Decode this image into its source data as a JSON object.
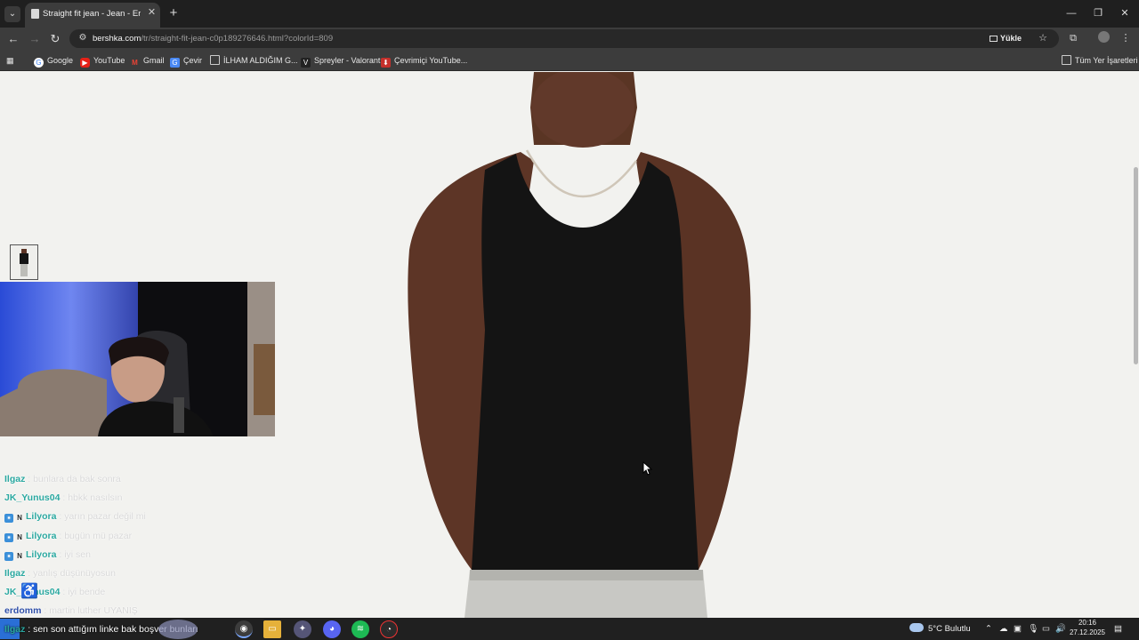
{
  "browser": {
    "tab_title": "Straight fit jean - Jean - Erkek |",
    "url_host": "bershka.com",
    "url_path": "/tr/straight-fit-jean-c0p189276646.html?colorId=809",
    "install_label": "Yükle",
    "bookmarks": [
      {
        "label": "Google",
        "icon": "google-icon"
      },
      {
        "label": "YouTube",
        "icon": "youtube-icon"
      },
      {
        "label": "Gmail",
        "icon": "gmail-icon"
      },
      {
        "label": "Çevir",
        "icon": "translate-icon"
      },
      {
        "label": "İLHAM ALDIĞIM G...",
        "icon": "folder-icon"
      },
      {
        "label": "Spreyler - Valorant",
        "icon": "valorant-icon"
      },
      {
        "label": "Çevrimiçi YouTube...",
        "icon": "bookmark-icon"
      }
    ],
    "all_bookmarks_label": "Tüm Yer İşaretleri"
  },
  "chat": [
    {
      "user": "Ilgaz",
      "message": " : bunlara da bak sonra",
      "badges": false
    },
    {
      "user": "JK_Yunus04",
      "message": " : hbkk nasılsın",
      "badges": false
    },
    {
      "user": "Lilyora",
      "message": " : yarın pazar değil mi",
      "badges": true
    },
    {
      "user": "Lilyora",
      "message": " : bugün mü pazar",
      "badges": true
    },
    {
      "user": "Lilyora",
      "message": " : iyi sen",
      "badges": true
    },
    {
      "user": "Ilgaz",
      "message": " : yanlış düşünüyosun",
      "badges": false
    },
    {
      "user": "JK_Yunus04",
      "message": " : iyi bende",
      "badges": false
    },
    {
      "user": "erdomm",
      "message": " : martin luther UYANIŞ",
      "badges": false
    },
    {
      "user": "Ilgaz",
      "message": " : sen son attığım linke bak boşver bunları",
      "badges": false
    }
  ],
  "taskbar": {
    "weather": "5°C  Bulutlu",
    "time": "20:16",
    "date": "27.12.2025"
  },
  "colors": {
    "page_bg": "#f2f2ef",
    "chrome_dark": "#1f1f1f",
    "toolbar": "#3c3c3c",
    "chat_user": "#2aa8a0"
  }
}
